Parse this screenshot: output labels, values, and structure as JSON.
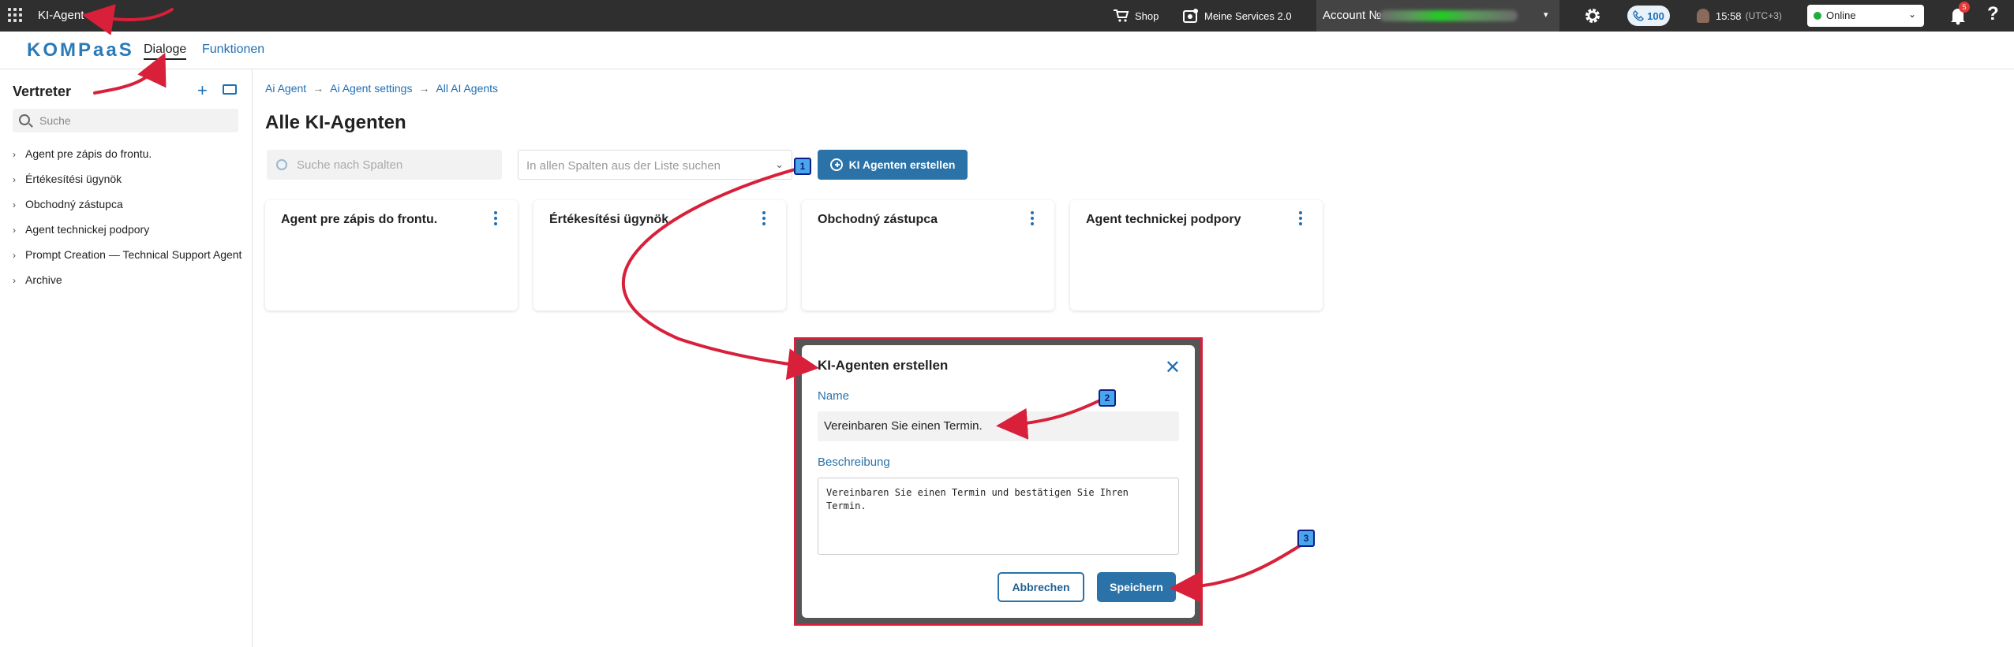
{
  "topbar": {
    "app_title": "KI-Agent",
    "shop_label": "Shop",
    "services_label": "Meine Services 2.0",
    "account_label": "Account №",
    "phone_count": "100",
    "time": "15:58",
    "timezone": "(UTC+3)",
    "status_value": "Online",
    "notification_count": "5",
    "help_symbol": "?"
  },
  "nav": {
    "logo": "KOMPaaS",
    "tabs": [
      {
        "label": "Dialoge",
        "active": true
      },
      {
        "label": "Funktionen",
        "active": false
      }
    ]
  },
  "sidebar": {
    "title": "Vertreter",
    "search_placeholder": "Suche",
    "items": [
      {
        "label": "Agent pre zápis do frontu."
      },
      {
        "label": "Értékesítési ügynök"
      },
      {
        "label": "Obchodný zástupca"
      },
      {
        "label": "Agent technickej podpory"
      },
      {
        "label": "Prompt Creation — Technical Support Agent"
      },
      {
        "label": "Archive"
      }
    ]
  },
  "main": {
    "breadcrumb": [
      "Ai Agent",
      "Ai Agent settings",
      "All AI Agents"
    ],
    "title": "Alle KI-Agenten",
    "search_placeholder": "Suche nach Spalten",
    "column_select_placeholder": "In allen Spalten aus der Liste suchen",
    "create_button": "KI Agenten erstellen",
    "cards": [
      {
        "name": "Agent pre zápis do frontu."
      },
      {
        "name": "Értékesítési ügynök"
      },
      {
        "name": "Obchodný zástupca"
      },
      {
        "name": "Agent technickej podpory"
      }
    ]
  },
  "dialog": {
    "title": "KI-Agenten erstellen",
    "name_label": "Name",
    "name_value": "Vereinbaren Sie einen Termin.",
    "description_label": "Beschreibung",
    "description_value": "Vereinbaren Sie einen Termin und bestätigen Sie Ihren Termin.",
    "cancel_button": "Abbrechen",
    "save_button": "Speichern"
  },
  "annotations": {
    "step_badges": [
      "1",
      "2",
      "3"
    ],
    "arrow_color": "#d8203a",
    "badge_color": "#4aa6e8"
  },
  "colors": {
    "brand": "#2a72a8",
    "link": "#1f6fb2",
    "topbar_bg": "#2f2f2f",
    "status_online": "#1fae3d"
  }
}
